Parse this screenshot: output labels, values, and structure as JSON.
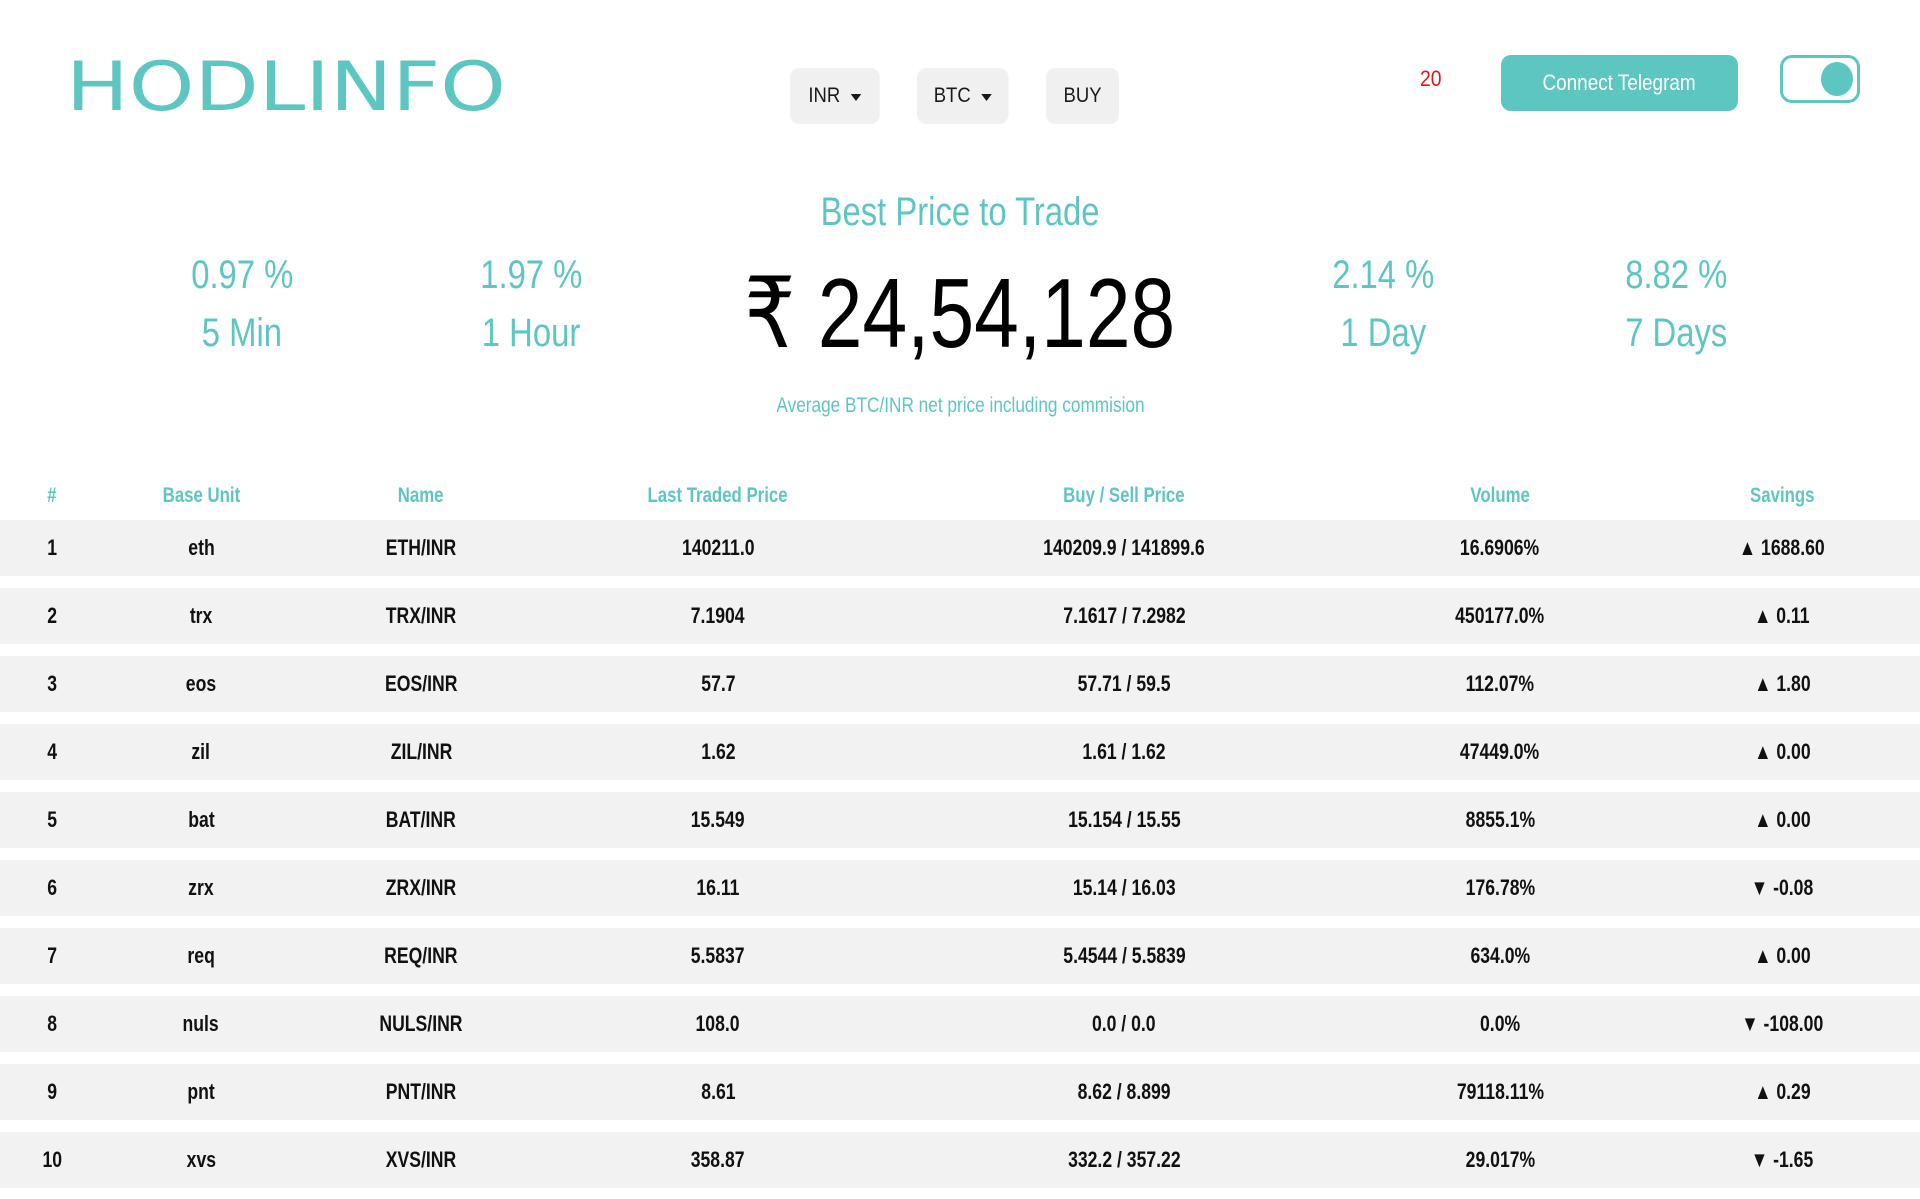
{
  "header": {
    "logo_text": "HODLINFO",
    "nav": [
      {
        "label": "INR",
        "has_caret": true
      },
      {
        "label": "BTC",
        "has_caret": true
      },
      {
        "label": "BUY",
        "has_caret": false
      }
    ],
    "timer": "20",
    "telegram_label": "Connect Telegram",
    "theme_toggle": "on"
  },
  "hero": {
    "title": "Best Price to Trade",
    "price": "₹ 24,54,128",
    "subtitle": "Average BTC/INR net price including commision",
    "stats": [
      {
        "value": "0.97 %",
        "label": "5 Min"
      },
      {
        "value": "1.97 %",
        "label": "1 Hour"
      },
      {
        "value": "2.14 %",
        "label": "1 Day"
      },
      {
        "value": "8.82 %",
        "label": "7 Days"
      }
    ]
  },
  "table": {
    "headers": [
      "#",
      "Base Unit",
      "Name",
      "Last Traded Price",
      "Buy / Sell Price",
      "Volume",
      "Savings"
    ],
    "rows": [
      [
        "1",
        "eth",
        "ETH/INR",
        "140211.0",
        "140209.9 / 141899.6",
        "16.6906%",
        "▲ 1688.60"
      ],
      [
        "2",
        "trx",
        "TRX/INR",
        "7.1904",
        "7.1617 / 7.2982",
        "450177.0%",
        "▲ 0.11"
      ],
      [
        "3",
        "eos",
        "EOS/INR",
        "57.7",
        "57.71 / 59.5",
        "112.07%",
        "▲ 1.80"
      ],
      [
        "4",
        "zil",
        "ZIL/INR",
        "1.62",
        "1.61 / 1.62",
        "47449.0%",
        "▲ 0.00"
      ],
      [
        "5",
        "bat",
        "BAT/INR",
        "15.549",
        "15.154 / 15.55",
        "8855.1%",
        "▲ 0.00"
      ],
      [
        "6",
        "zrx",
        "ZRX/INR",
        "16.11",
        "15.14 / 16.03",
        "176.78%",
        "▼ -0.08"
      ],
      [
        "7",
        "req",
        "REQ/INR",
        "5.5837",
        "5.4544 / 5.5839",
        "634.0%",
        "▲ 0.00"
      ],
      [
        "8",
        "nuls",
        "NULS/INR",
        "108.0",
        "0.0 / 0.0",
        "0.0%",
        "▼ -108.00"
      ],
      [
        "9",
        "pnt",
        "PNT/INR",
        "8.61",
        "8.62 / 8.899",
        "79118.11%",
        "▲ 0.29"
      ],
      [
        "10",
        "xvs",
        "XVS/INR",
        "358.87",
        "332.2 / 357.22",
        "29.017%",
        "▼ -1.65"
      ]
    ]
  },
  "colors": {
    "accent": "#5dc6c0",
    "timer": "#e0161b",
    "row_bg": "#f2f2f2"
  }
}
